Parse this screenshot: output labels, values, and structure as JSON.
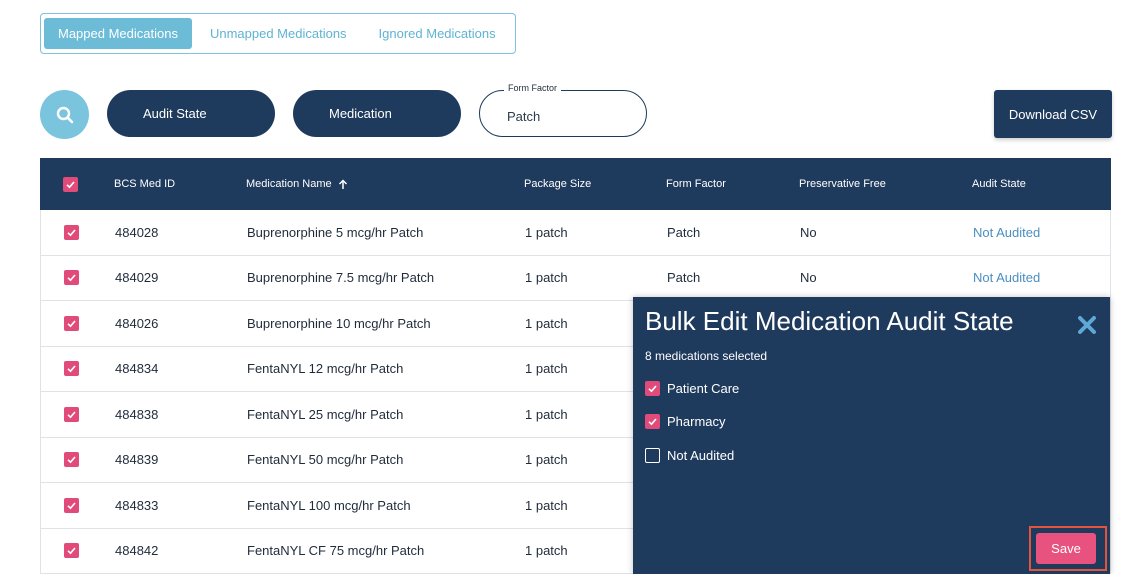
{
  "tabs": [
    {
      "label": "Mapped Medications",
      "active": true
    },
    {
      "label": "Unmapped Medications",
      "active": false
    },
    {
      "label": "Ignored Medications",
      "active": false
    }
  ],
  "filters": {
    "audit_state_label": "Audit State",
    "medication_label": "Medication",
    "form_factor_label": "Form Factor",
    "form_factor_value": "Patch",
    "download_label": "Download CSV"
  },
  "table": {
    "headers": {
      "id": "BCS Med ID",
      "name": "Medication Name",
      "package": "Package Size",
      "form_factor": "Form Factor",
      "preservative": "Preservative Free",
      "audit_state": "Audit State"
    },
    "rows": [
      {
        "id": "484028",
        "name": "Buprenorphine 5 mcg/hr Patch",
        "package": "1 patch",
        "form_factor": "Patch",
        "preservative": "No",
        "audit_state": "Not Audited"
      },
      {
        "id": "484029",
        "name": "Buprenorphine 7.5 mcg/hr Patch",
        "package": "1 patch",
        "form_factor": "Patch",
        "preservative": "No",
        "audit_state": "Not Audited"
      },
      {
        "id": "484026",
        "name": "Buprenorphine 10 mcg/hr Patch",
        "package": "1 patch",
        "form_factor": "",
        "preservative": "",
        "audit_state": ""
      },
      {
        "id": "484834",
        "name": "FentaNYL 12 mcg/hr Patch",
        "package": "1 patch",
        "form_factor": "",
        "preservative": "",
        "audit_state": ""
      },
      {
        "id": "484838",
        "name": "FentaNYL 25 mcg/hr Patch",
        "package": "1 patch",
        "form_factor": "",
        "preservative": "",
        "audit_state": ""
      },
      {
        "id": "484839",
        "name": "FentaNYL 50 mcg/hr Patch",
        "package": "1 patch",
        "form_factor": "",
        "preservative": "",
        "audit_state": ""
      },
      {
        "id": "484833",
        "name": "FentaNYL 100 mcg/hr Patch",
        "package": "1 patch",
        "form_factor": "",
        "preservative": "",
        "audit_state": ""
      },
      {
        "id": "484842",
        "name": "FentaNYL CF 75 mcg/hr Patch",
        "package": "1 patch",
        "form_factor": "",
        "preservative": "",
        "audit_state": ""
      }
    ]
  },
  "modal": {
    "title": "Bulk Edit Medication Audit State",
    "selected_text": "8 medications selected",
    "options": [
      {
        "label": "Patient Care",
        "checked": true
      },
      {
        "label": "Pharmacy",
        "checked": true
      },
      {
        "label": "Not Audited",
        "checked": false
      }
    ],
    "save_label": "Save"
  },
  "colors": {
    "navy": "#1e3a5c",
    "accent_pink": "#e04b7a",
    "light_blue": "#7bc4de",
    "link_blue": "#4a8ec2",
    "highlight_red": "#e2543b"
  },
  "icons": {
    "search": "search-icon",
    "sort": "arrow-up-icon",
    "close": "close-icon",
    "check": "check-icon"
  }
}
